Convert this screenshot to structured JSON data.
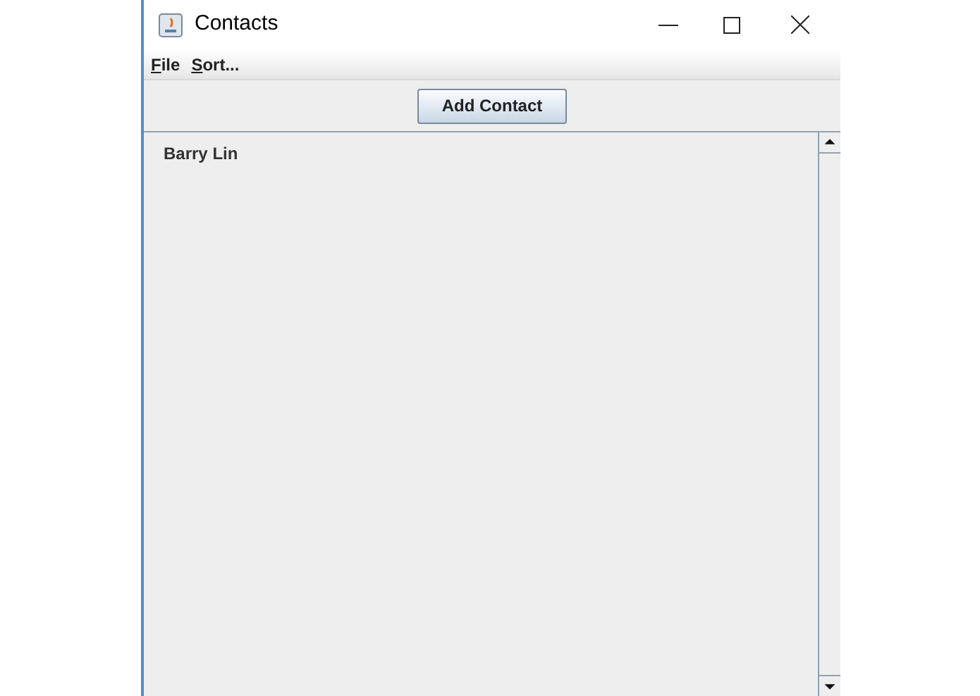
{
  "window": {
    "title": "Contacts"
  },
  "menu": [
    {
      "label": "File",
      "mnemonic_underlined": true
    },
    {
      "label": "Sort...",
      "mnemonic_underlined": true
    }
  ],
  "toolbar": {
    "button": "Add Contact"
  },
  "contacts": [
    {
      "name": "Barry Lin"
    }
  ]
}
